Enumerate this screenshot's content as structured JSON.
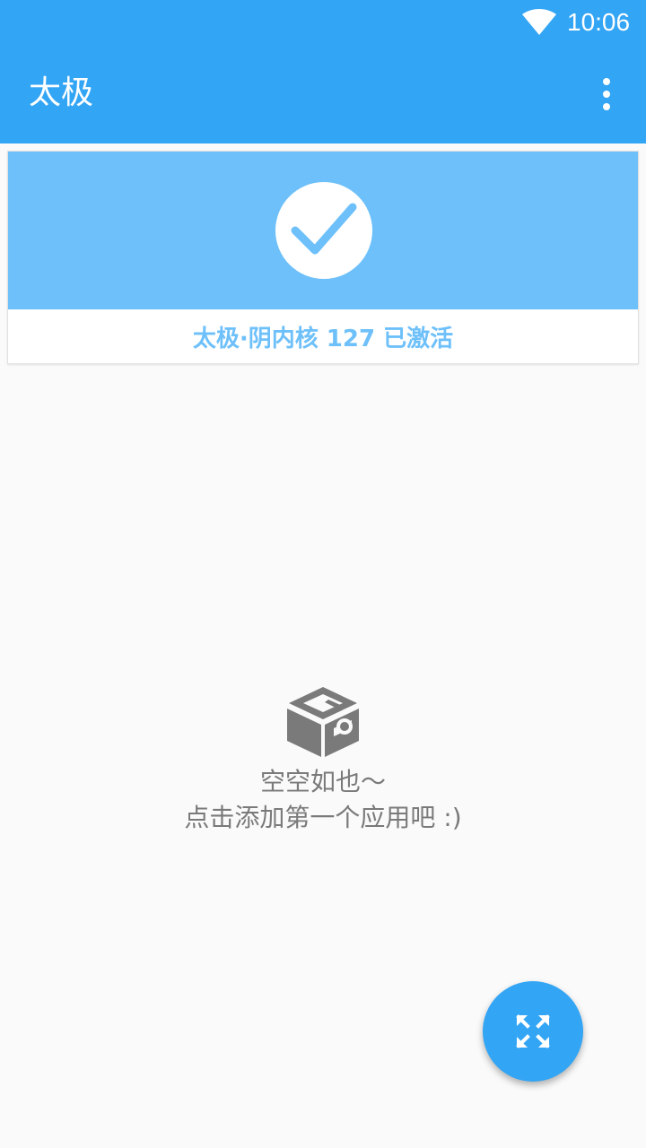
{
  "status_bar": {
    "time": "10:06",
    "wifi_icon": "wifi-icon"
  },
  "app_bar": {
    "title": "太极",
    "overflow_icon": "more-vert-icon"
  },
  "status_card": {
    "icon": "check-icon",
    "text": "太极·阴内核 127 已激活"
  },
  "empty_state": {
    "icon": "box-icon",
    "line1": "空空如也～",
    "line2": "点击添加第一个应用吧 :)"
  },
  "fab": {
    "icon": "expand-icon"
  },
  "colors": {
    "primary": "#33a5f5",
    "banner": "#6ec0fa",
    "background": "#fafafa",
    "empty_text": "#7a7a7a"
  }
}
